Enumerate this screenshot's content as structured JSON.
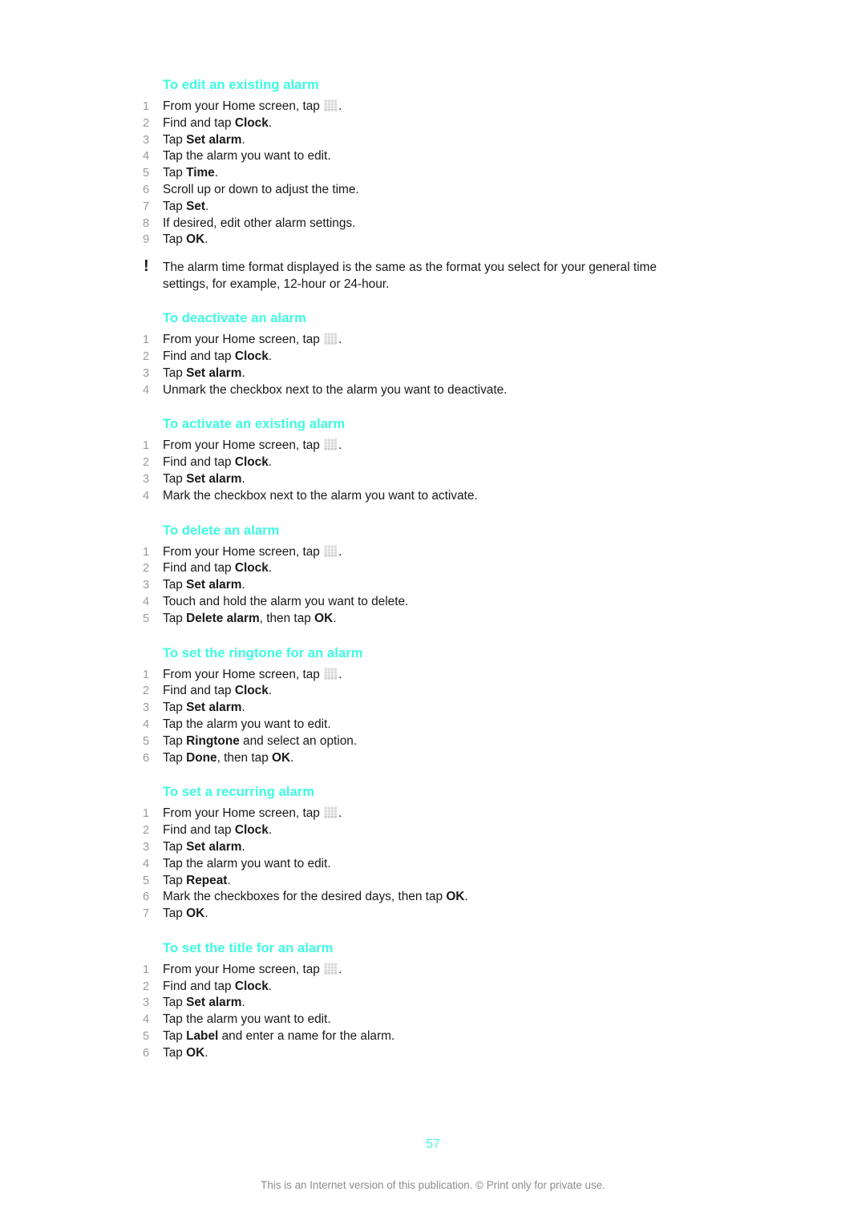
{
  "document": {
    "page_number": "57",
    "footer": "This is an Internet version of this publication. © Print only for private use.",
    "heading_color": "#3dfbe0",
    "number_color": "#9a9a9a",
    "body_color": "#1a1a1a",
    "footer_color": "#8c8c8c"
  },
  "icons": {
    "app_drawer": "app-drawer-grid-icon",
    "note": "exclamation-icon",
    "note_glyph": "!"
  },
  "sections": [
    {
      "heading": "To edit an existing alarm",
      "steps": [
        {
          "num": "1",
          "parts": [
            {
              "t": "From your Home screen, tap ",
              "b": false
            },
            {
              "icon": "app-drawer"
            },
            {
              "t": ".",
              "b": false
            }
          ]
        },
        {
          "num": "2",
          "parts": [
            {
              "t": "Find and tap ",
              "b": false
            },
            {
              "t": "Clock",
              "b": true
            },
            {
              "t": ".",
              "b": false
            }
          ]
        },
        {
          "num": "3",
          "parts": [
            {
              "t": "Tap ",
              "b": false
            },
            {
              "t": "Set alarm",
              "b": true
            },
            {
              "t": ".",
              "b": false
            }
          ]
        },
        {
          "num": "4",
          "parts": [
            {
              "t": "Tap the alarm you want to edit.",
              "b": false
            }
          ]
        },
        {
          "num": "5",
          "parts": [
            {
              "t": "Tap ",
              "b": false
            },
            {
              "t": "Time",
              "b": true
            },
            {
              "t": ".",
              "b": false
            }
          ]
        },
        {
          "num": "6",
          "parts": [
            {
              "t": "Scroll up or down to adjust the time.",
              "b": false
            }
          ]
        },
        {
          "num": "7",
          "parts": [
            {
              "t": "Tap ",
              "b": false
            },
            {
              "t": "Set",
              "b": true
            },
            {
              "t": ".",
              "b": false
            }
          ]
        },
        {
          "num": "8",
          "parts": [
            {
              "t": "If desired, edit other alarm settings.",
              "b": false
            }
          ]
        },
        {
          "num": "9",
          "parts": [
            {
              "t": "Tap ",
              "b": false
            },
            {
              "t": "OK",
              "b": true
            },
            {
              "t": ".",
              "b": false
            }
          ]
        }
      ],
      "note": "The alarm time format displayed is the same as the format you select for your general time settings, for example, 12-hour or 24-hour."
    },
    {
      "heading": "To deactivate an alarm",
      "steps": [
        {
          "num": "1",
          "parts": [
            {
              "t": "From your Home screen, tap ",
              "b": false
            },
            {
              "icon": "app-drawer"
            },
            {
              "t": ".",
              "b": false
            }
          ]
        },
        {
          "num": "2",
          "parts": [
            {
              "t": "Find and tap ",
              "b": false
            },
            {
              "t": "Clock",
              "b": true
            },
            {
              "t": ".",
              "b": false
            }
          ]
        },
        {
          "num": "3",
          "parts": [
            {
              "t": "Tap ",
              "b": false
            },
            {
              "t": "Set alarm",
              "b": true
            },
            {
              "t": ".",
              "b": false
            }
          ]
        },
        {
          "num": "4",
          "parts": [
            {
              "t": "Unmark the checkbox next to the alarm you want to deactivate.",
              "b": false
            }
          ]
        }
      ],
      "note": null
    },
    {
      "heading": "To activate an existing alarm",
      "steps": [
        {
          "num": "1",
          "parts": [
            {
              "t": "From your Home screen, tap ",
              "b": false
            },
            {
              "icon": "app-drawer"
            },
            {
              "t": ".",
              "b": false
            }
          ]
        },
        {
          "num": "2",
          "parts": [
            {
              "t": "Find and tap ",
              "b": false
            },
            {
              "t": "Clock",
              "b": true
            },
            {
              "t": ".",
              "b": false
            }
          ]
        },
        {
          "num": "3",
          "parts": [
            {
              "t": "Tap ",
              "b": false
            },
            {
              "t": "Set alarm",
              "b": true
            },
            {
              "t": ".",
              "b": false
            }
          ]
        },
        {
          "num": "4",
          "parts": [
            {
              "t": "Mark the checkbox next to the alarm you want to activate.",
              "b": false
            }
          ]
        }
      ],
      "note": null
    },
    {
      "heading": "To delete an alarm",
      "steps": [
        {
          "num": "1",
          "parts": [
            {
              "t": "From your Home screen, tap ",
              "b": false
            },
            {
              "icon": "app-drawer"
            },
            {
              "t": ".",
              "b": false
            }
          ]
        },
        {
          "num": "2",
          "parts": [
            {
              "t": "Find and tap ",
              "b": false
            },
            {
              "t": "Clock",
              "b": true
            },
            {
              "t": ".",
              "b": false
            }
          ]
        },
        {
          "num": "3",
          "parts": [
            {
              "t": "Tap ",
              "b": false
            },
            {
              "t": "Set alarm",
              "b": true
            },
            {
              "t": ".",
              "b": false
            }
          ]
        },
        {
          "num": "4",
          "parts": [
            {
              "t": "Touch and hold the alarm you want to delete.",
              "b": false
            }
          ]
        },
        {
          "num": "5",
          "parts": [
            {
              "t": "Tap ",
              "b": false
            },
            {
              "t": "Delete alarm",
              "b": true
            },
            {
              "t": ", then tap ",
              "b": false
            },
            {
              "t": "OK",
              "b": true
            },
            {
              "t": ".",
              "b": false
            }
          ]
        }
      ],
      "note": null
    },
    {
      "heading": "To set the ringtone for an alarm",
      "steps": [
        {
          "num": "1",
          "parts": [
            {
              "t": "From your Home screen, tap ",
              "b": false
            },
            {
              "icon": "app-drawer"
            },
            {
              "t": ".",
              "b": false
            }
          ]
        },
        {
          "num": "2",
          "parts": [
            {
              "t": "Find and tap ",
              "b": false
            },
            {
              "t": "Clock",
              "b": true
            },
            {
              "t": ".",
              "b": false
            }
          ]
        },
        {
          "num": "3",
          "parts": [
            {
              "t": "Tap ",
              "b": false
            },
            {
              "t": "Set alarm",
              "b": true
            },
            {
              "t": ".",
              "b": false
            }
          ]
        },
        {
          "num": "4",
          "parts": [
            {
              "t": "Tap the alarm you want to edit.",
              "b": false
            }
          ]
        },
        {
          "num": "5",
          "parts": [
            {
              "t": "Tap ",
              "b": false
            },
            {
              "t": "Ringtone",
              "b": true
            },
            {
              "t": " and select an option.",
              "b": false
            }
          ]
        },
        {
          "num": "6",
          "parts": [
            {
              "t": "Tap ",
              "b": false
            },
            {
              "t": "Done",
              "b": true
            },
            {
              "t": ", then tap ",
              "b": false
            },
            {
              "t": "OK",
              "b": true
            },
            {
              "t": ".",
              "b": false
            }
          ]
        }
      ],
      "note": null
    },
    {
      "heading": "To set a recurring alarm",
      "steps": [
        {
          "num": "1",
          "parts": [
            {
              "t": "From your Home screen, tap ",
              "b": false
            },
            {
              "icon": "app-drawer"
            },
            {
              "t": ".",
              "b": false
            }
          ]
        },
        {
          "num": "2",
          "parts": [
            {
              "t": "Find and tap ",
              "b": false
            },
            {
              "t": "Clock",
              "b": true
            },
            {
              "t": ".",
              "b": false
            }
          ]
        },
        {
          "num": "3",
          "parts": [
            {
              "t": "Tap ",
              "b": false
            },
            {
              "t": "Set alarm",
              "b": true
            },
            {
              "t": ".",
              "b": false
            }
          ]
        },
        {
          "num": "4",
          "parts": [
            {
              "t": "Tap the alarm you want to edit.",
              "b": false
            }
          ]
        },
        {
          "num": "5",
          "parts": [
            {
              "t": "Tap ",
              "b": false
            },
            {
              "t": "Repeat",
              "b": true
            },
            {
              "t": ".",
              "b": false
            }
          ]
        },
        {
          "num": "6",
          "parts": [
            {
              "t": "Mark the checkboxes for the desired days, then tap ",
              "b": false
            },
            {
              "t": "OK",
              "b": true
            },
            {
              "t": ".",
              "b": false
            }
          ]
        },
        {
          "num": "7",
          "parts": [
            {
              "t": "Tap ",
              "b": false
            },
            {
              "t": "OK",
              "b": true
            },
            {
              "t": ".",
              "b": false
            }
          ]
        }
      ],
      "note": null
    },
    {
      "heading": "To set the title for an alarm",
      "steps": [
        {
          "num": "1",
          "parts": [
            {
              "t": "From your Home screen, tap ",
              "b": false
            },
            {
              "icon": "app-drawer"
            },
            {
              "t": ".",
              "b": false
            }
          ]
        },
        {
          "num": "2",
          "parts": [
            {
              "t": "Find and tap ",
              "b": false
            },
            {
              "t": "Clock",
              "b": true
            },
            {
              "t": ".",
              "b": false
            }
          ]
        },
        {
          "num": "3",
          "parts": [
            {
              "t": "Tap ",
              "b": false
            },
            {
              "t": "Set alarm",
              "b": true
            },
            {
              "t": ".",
              "b": false
            }
          ]
        },
        {
          "num": "4",
          "parts": [
            {
              "t": "Tap the alarm you want to edit.",
              "b": false
            }
          ]
        },
        {
          "num": "5",
          "parts": [
            {
              "t": "Tap ",
              "b": false
            },
            {
              "t": "Label",
              "b": true
            },
            {
              "t": " and enter a name for the alarm.",
              "b": false
            }
          ]
        },
        {
          "num": "6",
          "parts": [
            {
              "t": "Tap ",
              "b": false
            },
            {
              "t": "OK",
              "b": true
            },
            {
              "t": ".",
              "b": false
            }
          ]
        }
      ],
      "note": null
    }
  ]
}
